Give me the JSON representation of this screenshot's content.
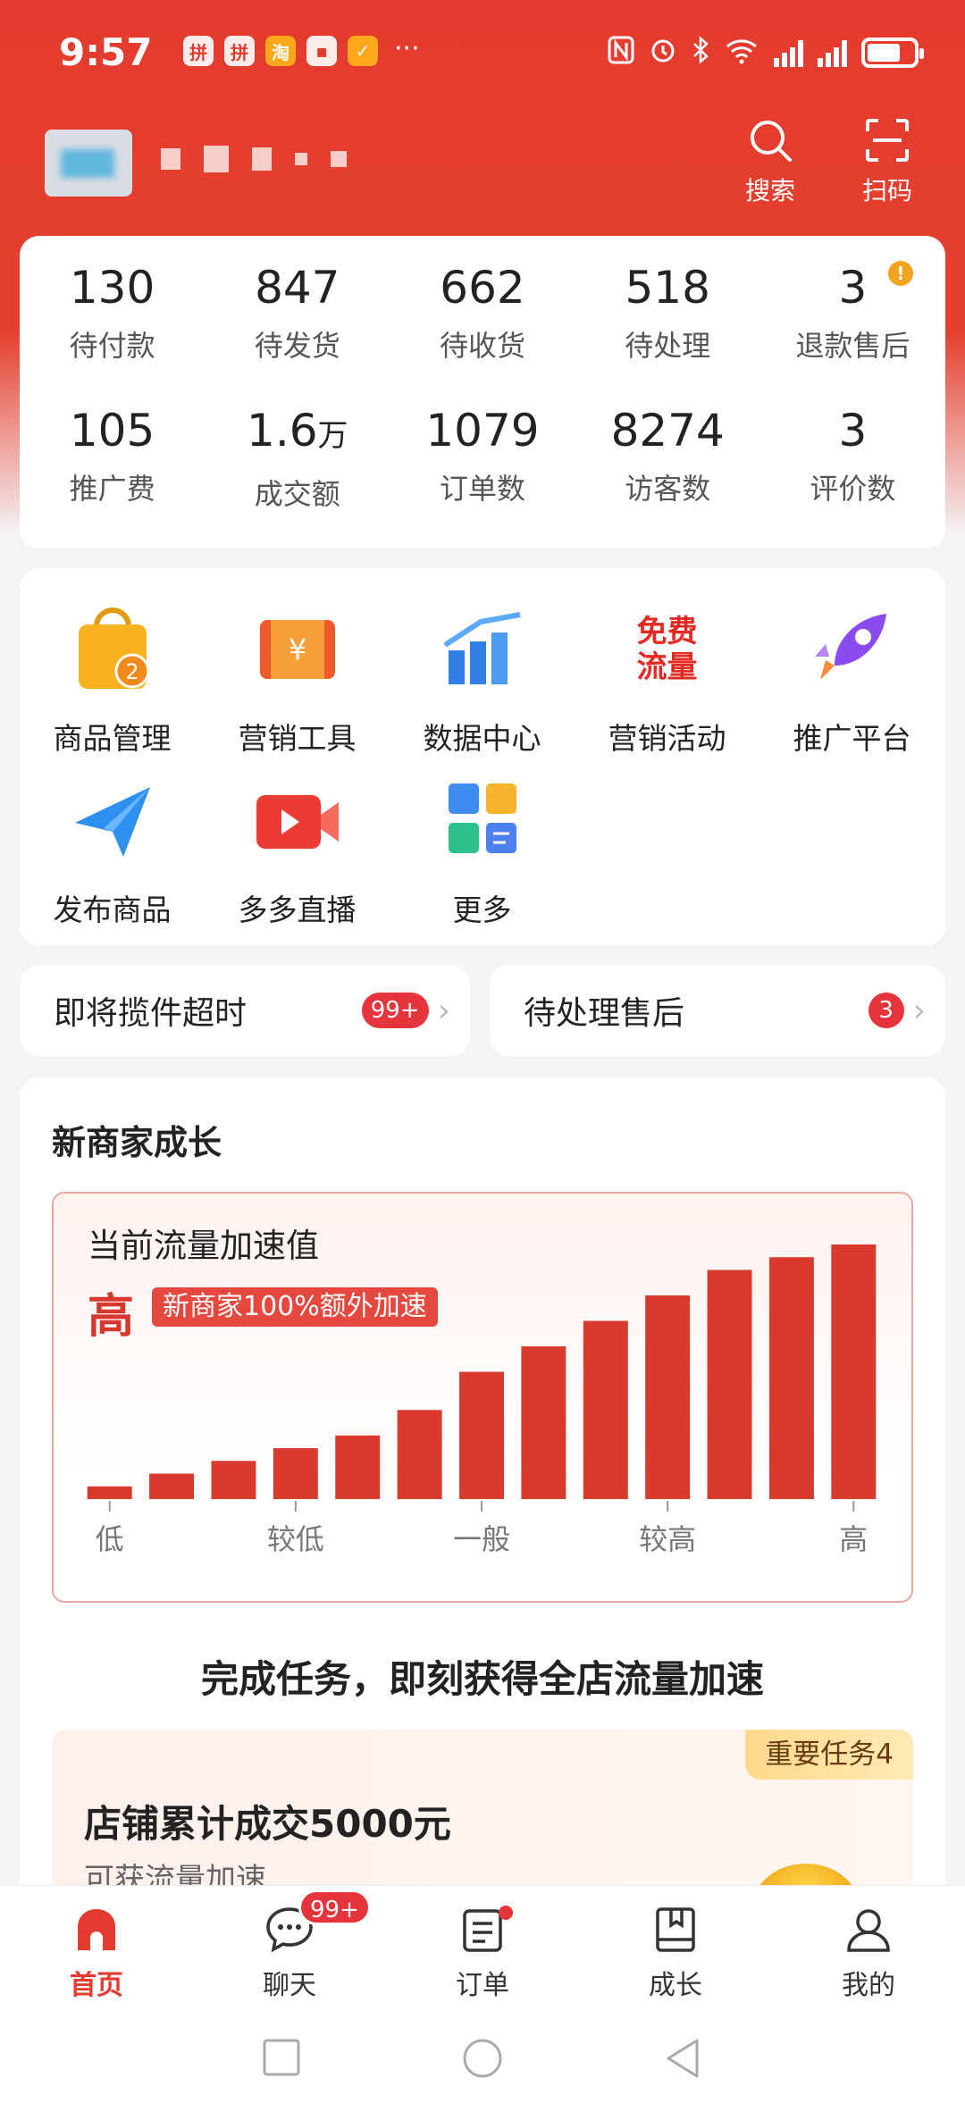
{
  "status_bar": {
    "time": "9:57",
    "app_icons": [
      "拼",
      "拼",
      "淘",
      "▪",
      "✓"
    ],
    "more": "···"
  },
  "header": {
    "search_label": "搜索",
    "scan_label": "扫码"
  },
  "stats": [
    {
      "value": "130",
      "label": "待付款"
    },
    {
      "value": "847",
      "label": "待发货"
    },
    {
      "value": "662",
      "label": "待收货"
    },
    {
      "value": "518",
      "label": "待处理"
    },
    {
      "value": "3",
      "label": "退款售后",
      "badge": "!"
    },
    {
      "value": "105",
      "label": "推广费"
    },
    {
      "value": "1.6",
      "unit": "万",
      "label": "成交额"
    },
    {
      "value": "1079",
      "label": "订单数"
    },
    {
      "value": "8274",
      "label": "访客数"
    },
    {
      "value": "3",
      "label": "评价数"
    }
  ],
  "tools": [
    {
      "label": "商品管理",
      "icon": "shopping-bag-icon",
      "badge": "2"
    },
    {
      "label": "营销工具",
      "icon": "coupon-icon"
    },
    {
      "label": "数据中心",
      "icon": "bar-chart-icon"
    },
    {
      "label": "营销活动",
      "icon": "free-traffic-icon",
      "icon_text_1": "免费",
      "icon_text_2": "流量"
    },
    {
      "label": "推广平台",
      "icon": "rocket-icon"
    },
    {
      "label": "发布商品",
      "icon": "paper-plane-icon"
    },
    {
      "label": "多多直播",
      "icon": "video-camera-icon"
    },
    {
      "label": "更多",
      "icon": "more-grid-icon"
    }
  ],
  "quick": {
    "left_label": "即将揽件超时",
    "left_badge": "99+",
    "right_label": "待处理售后",
    "right_badge": "3"
  },
  "growth": {
    "title": "新商家成长",
    "accel_title": "当前流量加速值",
    "accel_level": "高",
    "accel_tag": "新商家100%额外加速",
    "task_headline": "完成任务，即刻获得全店流量加速",
    "task_tag": "重要任务4",
    "task_title": "店铺累计成交5000元",
    "task_sub": "可获流量加速"
  },
  "chart_data": {
    "type": "bar",
    "title": "当前流量加速值",
    "tick_labels": [
      "低",
      "较低",
      "一般",
      "较高",
      "高"
    ],
    "values": [
      1,
      2,
      3,
      4,
      5,
      7,
      10,
      12,
      14,
      16,
      18,
      19,
      20
    ],
    "bar_color": "#d83a2e"
  },
  "tabbar": [
    {
      "label": "首页",
      "icon": "home-icon",
      "active": true
    },
    {
      "label": "聊天",
      "icon": "chat-icon",
      "badge": "99+"
    },
    {
      "label": "订单",
      "icon": "order-icon",
      "dot": true
    },
    {
      "label": "成长",
      "icon": "growth-book-icon"
    },
    {
      "label": "我的",
      "icon": "profile-icon"
    }
  ],
  "colors": {
    "brand": "#e33b2f",
    "badge": "#e5343b"
  }
}
